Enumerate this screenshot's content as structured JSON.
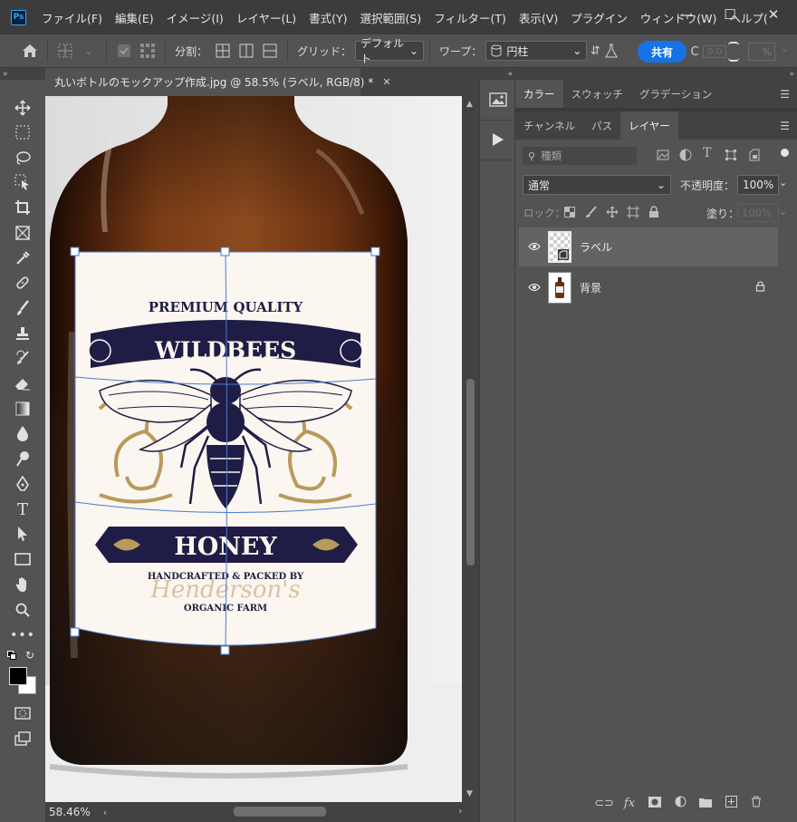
{
  "app": {
    "logo": "Ps"
  },
  "menu": [
    "ファイル(F)",
    "編集(E)",
    "イメージ(I)",
    "レイヤー(L)",
    "書式(Y)",
    "選択範囲(S)",
    "フィルター(T)",
    "表示(V)",
    "プラグイン",
    "ウィンドウ(W)",
    "ヘルプ("
  ],
  "window_controls": {
    "minimize": "—",
    "maximize": "☐",
    "close": "✕"
  },
  "options_bar": {
    "split_label": "分割：",
    "grid_label": "グリッド：",
    "grid_value": "デフォルト",
    "warp_label": "ワープ：",
    "warp_value": "円柱",
    "share_label": "共有",
    "extra_value": "0.0",
    "percent": "%"
  },
  "document": {
    "tab_title": "丸いボトルのモックアップ作成.jpg @ 58.5% (ラベル, RGB/8) *",
    "close_glyph": "✕",
    "zoom": "58.46%"
  },
  "label_art": {
    "premium": "PREMIUM QUALITY",
    "brand": "WILDBEES",
    "product": "HONEY",
    "crafted": "HANDCRAFTED & PACKED BY",
    "maker": "Henderson's",
    "farm": "ORGANIC FARM"
  },
  "panels": {
    "top_tabs": [
      "カラー",
      "スウォッチ",
      "グラデーション"
    ],
    "second_tabs": [
      "チャンネル",
      "パス",
      "レイヤー"
    ],
    "search_placeholder": "種類",
    "blend_mode": "通常",
    "opacity_label": "不透明度：",
    "opacity_value": "100%",
    "lock_label": "ロック：",
    "fill_label": "塗り：",
    "fill_value": "100%"
  },
  "layers": [
    {
      "name": "ラベル",
      "visible": true,
      "locked": false,
      "selected": true
    },
    {
      "name": "背景",
      "visible": true,
      "locked": true,
      "selected": false
    }
  ],
  "colors": {
    "accent": "#1473e6",
    "panel": "#535353",
    "dark": "#3c3c3c",
    "selection": "#636363",
    "label_navy": "#1f1d45",
    "label_gold": "#b89a5c"
  }
}
